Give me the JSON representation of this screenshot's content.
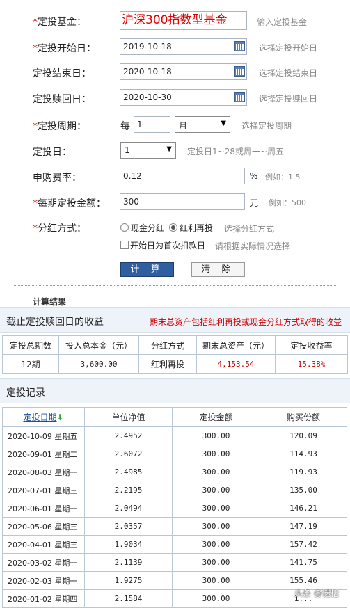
{
  "form": {
    "fund": {
      "label": "定投基金：",
      "required": true,
      "value": "沪深300指数型基金",
      "hint": "输入定投基金"
    },
    "start_date": {
      "label": "定投开始日：",
      "required": true,
      "value": "2019-10-18",
      "hint": "选择定投开始日"
    },
    "end_date": {
      "label": "定投结束日：",
      "required": false,
      "value": "2020-10-18",
      "hint": "选择定投结束日"
    },
    "redeem_date": {
      "label": "定投赎回日：",
      "required": false,
      "value": "2020-10-30",
      "hint": "选择定投赎回日"
    },
    "period": {
      "label": "定投周期：",
      "required": true,
      "prefix": "每",
      "value": "1",
      "unit": "月",
      "hint": "选择定投周期"
    },
    "day": {
      "label": "定投日：",
      "required": false,
      "value": "1",
      "hint": "定投日1~28或周一~周五"
    },
    "fee": {
      "label": "申购费率：",
      "required": false,
      "value": "0.12",
      "unit": "%",
      "hint": "例如：1.5"
    },
    "amount": {
      "label": "每期定投金额：",
      "required": true,
      "value": "300",
      "unit": "元",
      "hint": "例如：500"
    },
    "dividend": {
      "label": "分红方式：",
      "required": true,
      "options": [
        "现金分红",
        "红利再投"
      ],
      "selected": "红利再投",
      "hint": "选择分红方式"
    },
    "first_deduct": {
      "label": "开始日为首次扣款日",
      "checked": false,
      "hint": "请根据实际情况选择"
    },
    "calc_button": "计 算",
    "clear_button": "清 除"
  },
  "results": {
    "title": "计算结果",
    "summary_title": "截止定投赎回日的收益",
    "summary_note": "期末总资产包括红利再投或现金分红方式取得的收益",
    "summary_headers": [
      "定投总期数",
      "投入总本金（元）",
      "分红方式",
      "期末总资产（元）",
      "定投收益率"
    ],
    "summary_row": [
      "12期",
      "3,600.00",
      "红利再投",
      "4,153.54",
      "15.38%"
    ],
    "records_title": "定投记录",
    "records_headers": [
      "定投日期",
      "单位净值",
      "定投金额",
      "购买份额"
    ],
    "records": [
      {
        "date": "2020-10-09 星期五",
        "nav": "2.4952",
        "amount": "300.00",
        "shares": "120.09"
      },
      {
        "date": "2020-09-01 星期二",
        "nav": "2.6072",
        "amount": "300.00",
        "shares": "114.93"
      },
      {
        "date": "2020-08-03 星期一",
        "nav": "2.4985",
        "amount": "300.00",
        "shares": "119.93"
      },
      {
        "date": "2020-07-01 星期三",
        "nav": "2.2195",
        "amount": "300.00",
        "shares": "135.00"
      },
      {
        "date": "2020-06-01 星期一",
        "nav": "2.0494",
        "amount": "300.00",
        "shares": "146.21"
      },
      {
        "date": "2020-05-06 星期三",
        "nav": "2.0357",
        "amount": "300.00",
        "shares": "147.19"
      },
      {
        "date": "2020-04-01 星期三",
        "nav": "1.9034",
        "amount": "300.00",
        "shares": "157.42"
      },
      {
        "date": "2020-03-02 星期一",
        "nav": "2.1139",
        "amount": "300.00",
        "shares": "141.75"
      },
      {
        "date": "2020-02-03 星期一",
        "nav": "1.9275",
        "amount": "300.00",
        "shares": "155.46"
      },
      {
        "date": "2020-01-02 星期四",
        "nav": "2.1584",
        "amount": "300.00",
        "shares": "1..."
      }
    ]
  },
  "watermark": "头条 @谜栝",
  "icons": {
    "calendar": "calendar-icon",
    "sort": "sort-down-arrow-icon"
  }
}
